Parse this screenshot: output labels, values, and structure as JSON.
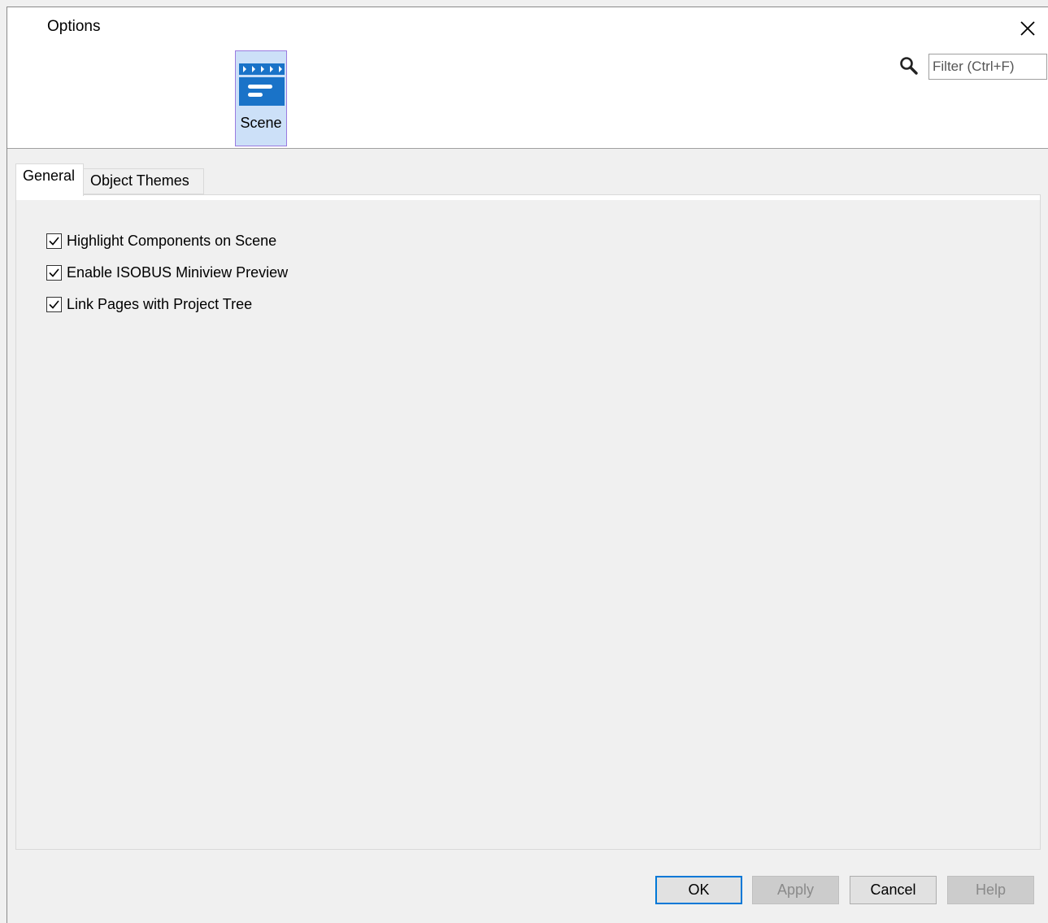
{
  "window": {
    "title": "Options",
    "close_icon": "close-icon"
  },
  "header": {
    "categories": [
      {
        "label": "Scene",
        "icon": "scene-icon",
        "selected": true
      }
    ],
    "filter": {
      "placeholder": "Filter (Ctrl+F)",
      "value": "",
      "icon": "search-icon"
    }
  },
  "tabs": [
    {
      "label": "General",
      "active": true
    },
    {
      "label": "Object Themes",
      "active": false
    }
  ],
  "general": {
    "options": [
      {
        "label": "Highlight Components on Scene",
        "checked": true
      },
      {
        "label": "Enable ISOBUS Miniview Preview",
        "checked": true
      },
      {
        "label": "Link Pages with Project Tree",
        "checked": true
      }
    ]
  },
  "buttons": {
    "ok": "OK",
    "apply": "Apply",
    "cancel": "Cancel",
    "help": "Help"
  },
  "colors": {
    "accent": "#0078d7",
    "scene_icon": "#1a73c8",
    "selected_bg": "#cce0f8"
  }
}
